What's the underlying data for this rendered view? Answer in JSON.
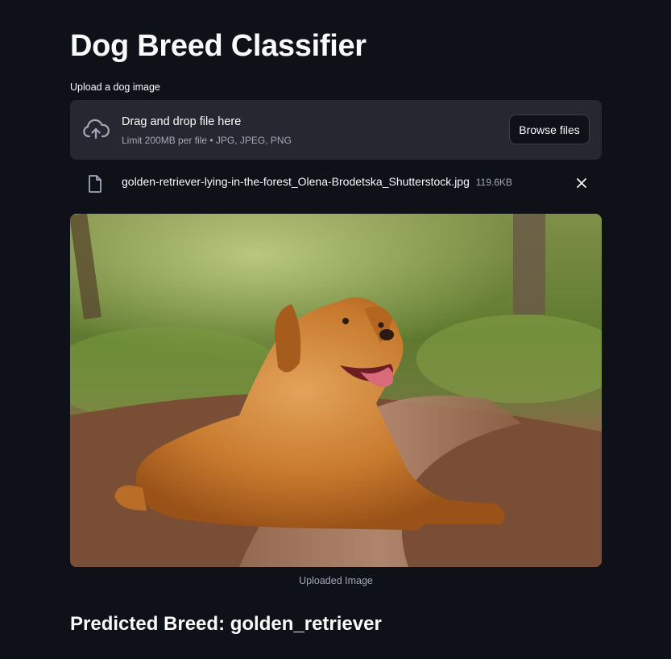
{
  "app": {
    "title": "Dog Breed Classifier"
  },
  "uploader": {
    "label": "Upload a dog image",
    "drop_text": "Drag and drop file here",
    "limit_text": "Limit 200MB per file • JPG, JPEG, PNG",
    "browse_label": "Browse files",
    "icon": "cloud-upload-icon"
  },
  "uploaded_file": {
    "name": "golden-retriever-lying-in-the-forest_Olena-Brodetska_Shutterstock.jpg",
    "size": "119.6KB",
    "icon": "file-icon",
    "remove_icon": "close-icon"
  },
  "image": {
    "caption": "Uploaded Image"
  },
  "result": {
    "text": "Predicted Breed: golden_retriever"
  },
  "colors": {
    "background": "#0e1117",
    "surface": "#262730",
    "text": "#fafafa",
    "muted": "#a3a8b8"
  }
}
